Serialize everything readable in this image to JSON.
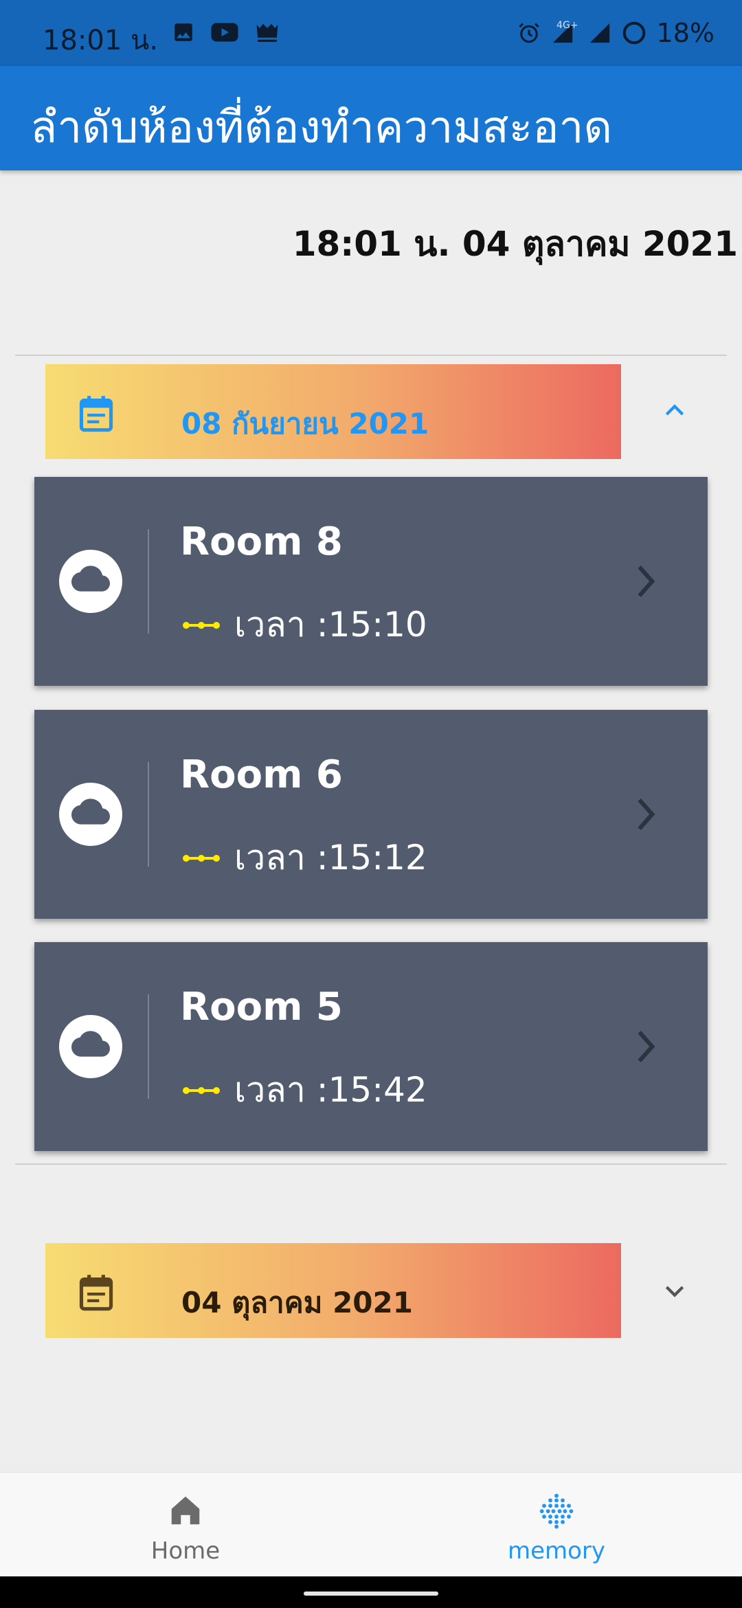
{
  "status_bar": {
    "time": "18:01 น.",
    "battery": "18%",
    "network": "4G+"
  },
  "app_bar": {
    "title": "ลำดับห้องที่ต้องทำความสะอาด"
  },
  "current_datetime": "18:01 น. 04 ตุลาคม 2021",
  "groups": [
    {
      "date": "08 กันยายน 2021",
      "expanded": true,
      "date_color": "#2196f3",
      "rooms": [
        {
          "name": "Room 8",
          "time": "เวลา :15:10"
        },
        {
          "name": "Room 6",
          "time": "เวลา :15:12"
        },
        {
          "name": "Room 5",
          "time": "เวลา :15:42"
        }
      ]
    },
    {
      "date": "04 ตุลาคม 2021",
      "expanded": false,
      "date_color": "#3a2a10",
      "rooms": []
    }
  ],
  "bottom_nav": {
    "home_label": "Home",
    "memory_label": "memory",
    "active": "memory"
  },
  "colors": {
    "app_bar": "#1976d2",
    "status_bar": "#1565b8",
    "card": "#525c6e",
    "accent": "#2196f3",
    "dots": "#ffeb00"
  }
}
